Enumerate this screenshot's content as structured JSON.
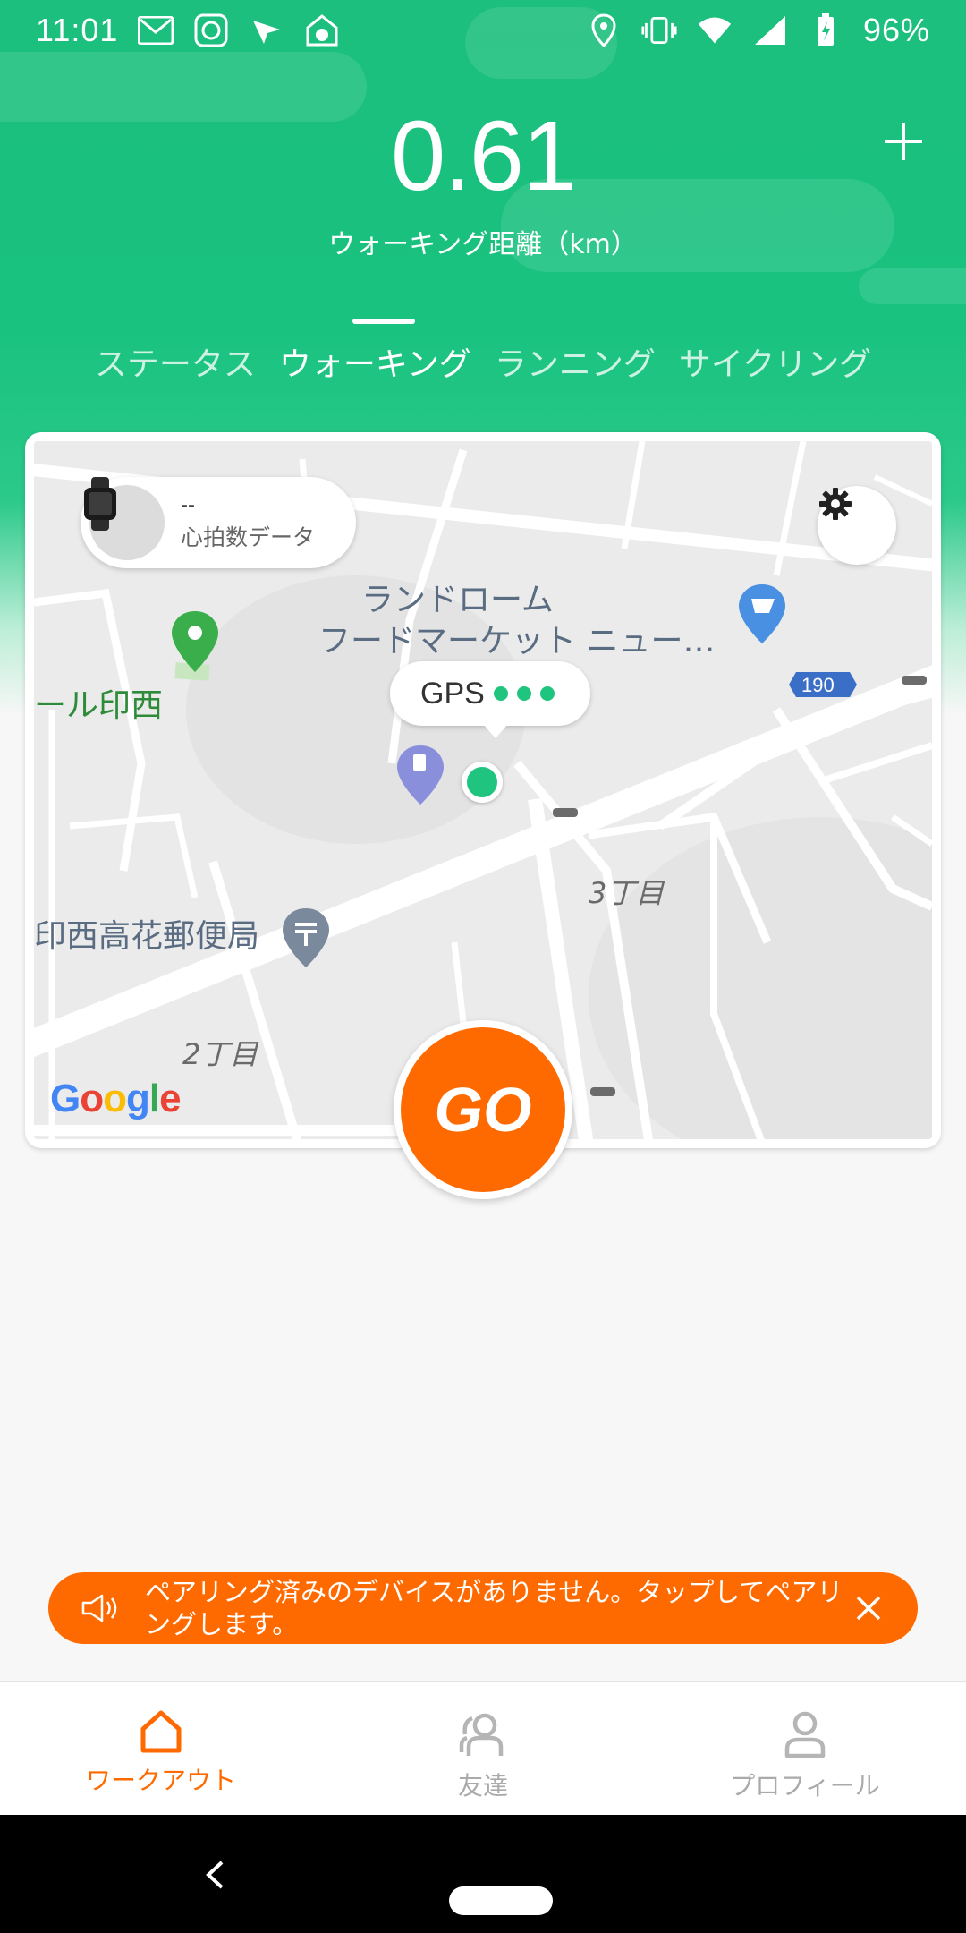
{
  "status_bar": {
    "time": "11:01",
    "battery": "96%",
    "left_icons": [
      "gmail-icon",
      "mi-fit-icon",
      "location-arrow-icon",
      "soccer-ball-icon"
    ],
    "right_icons": [
      "location-pin-icon",
      "vibrate-icon",
      "wifi-icon",
      "signal-icon",
      "battery-charging-icon"
    ]
  },
  "header": {
    "distance_value": "0.61",
    "distance_label": "ウォーキング距離（km）",
    "add_icon": "plus-icon"
  },
  "tabs": [
    {
      "label": "ステータス",
      "active": false
    },
    {
      "label": "ウォーキング",
      "active": true
    },
    {
      "label": "ランニング",
      "active": false
    },
    {
      "label": "サイクリング",
      "active": false
    }
  ],
  "map_card": {
    "heart_rate_value": "--",
    "heart_rate_label": "心拍数データ",
    "gps_label": "GPS",
    "labels": {
      "store_line1": "ランドローム",
      "store_line2": "フードマーケット ニュー…",
      "park": "ール印西",
      "post_office": "印西高花郵便局",
      "chome3": "3丁目",
      "chome2": "2丁目",
      "route": "190"
    },
    "google": "Google",
    "go_label": "GO"
  },
  "banner": {
    "text": "ペアリング済みのデバイスがありません。タップしてペアリングします。"
  },
  "bottom_nav": [
    {
      "label": "ワークアウト",
      "icon": "home-icon",
      "active": true
    },
    {
      "label": "友達",
      "icon": "friends-icon",
      "active": false
    },
    {
      "label": "プロフィール",
      "icon": "profile-icon",
      "active": false
    }
  ],
  "colors": {
    "brand_green": "#1cbf7d",
    "accent_orange": "#ff6a00"
  }
}
